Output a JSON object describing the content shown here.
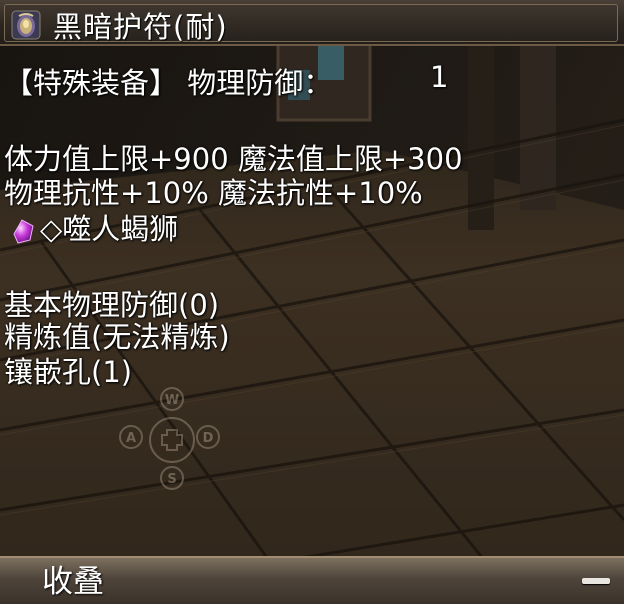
{
  "title": "黑暗护符(耐)",
  "item_icon": "amulet-icon",
  "special": {
    "tag": "【特殊装备】",
    "defense_label": "物理防御：",
    "defense_value": "1"
  },
  "stats_line_1": "体力值上限+900 魔法值上限+300",
  "stats_line_2": "物理抗性+10% 魔法抗性+10%",
  "gem": {
    "icon": "purple-gem-icon",
    "text": "◇噬人蝎狮"
  },
  "base_defense": "基本物理防御(0)",
  "refine": "精炼值(无法精炼)",
  "socket": "镶嵌孔(1)",
  "wasd": {
    "up": "W",
    "left": "A",
    "right": "D",
    "down": "S"
  },
  "footer": {
    "collapse_label": "收叠",
    "collapse_icon": "minus-icon"
  },
  "colors": {
    "text": "#ffffff",
    "title_bar": "#2c2620",
    "footer_bar": "#5a4e42",
    "gem": "#c83ad8"
  }
}
